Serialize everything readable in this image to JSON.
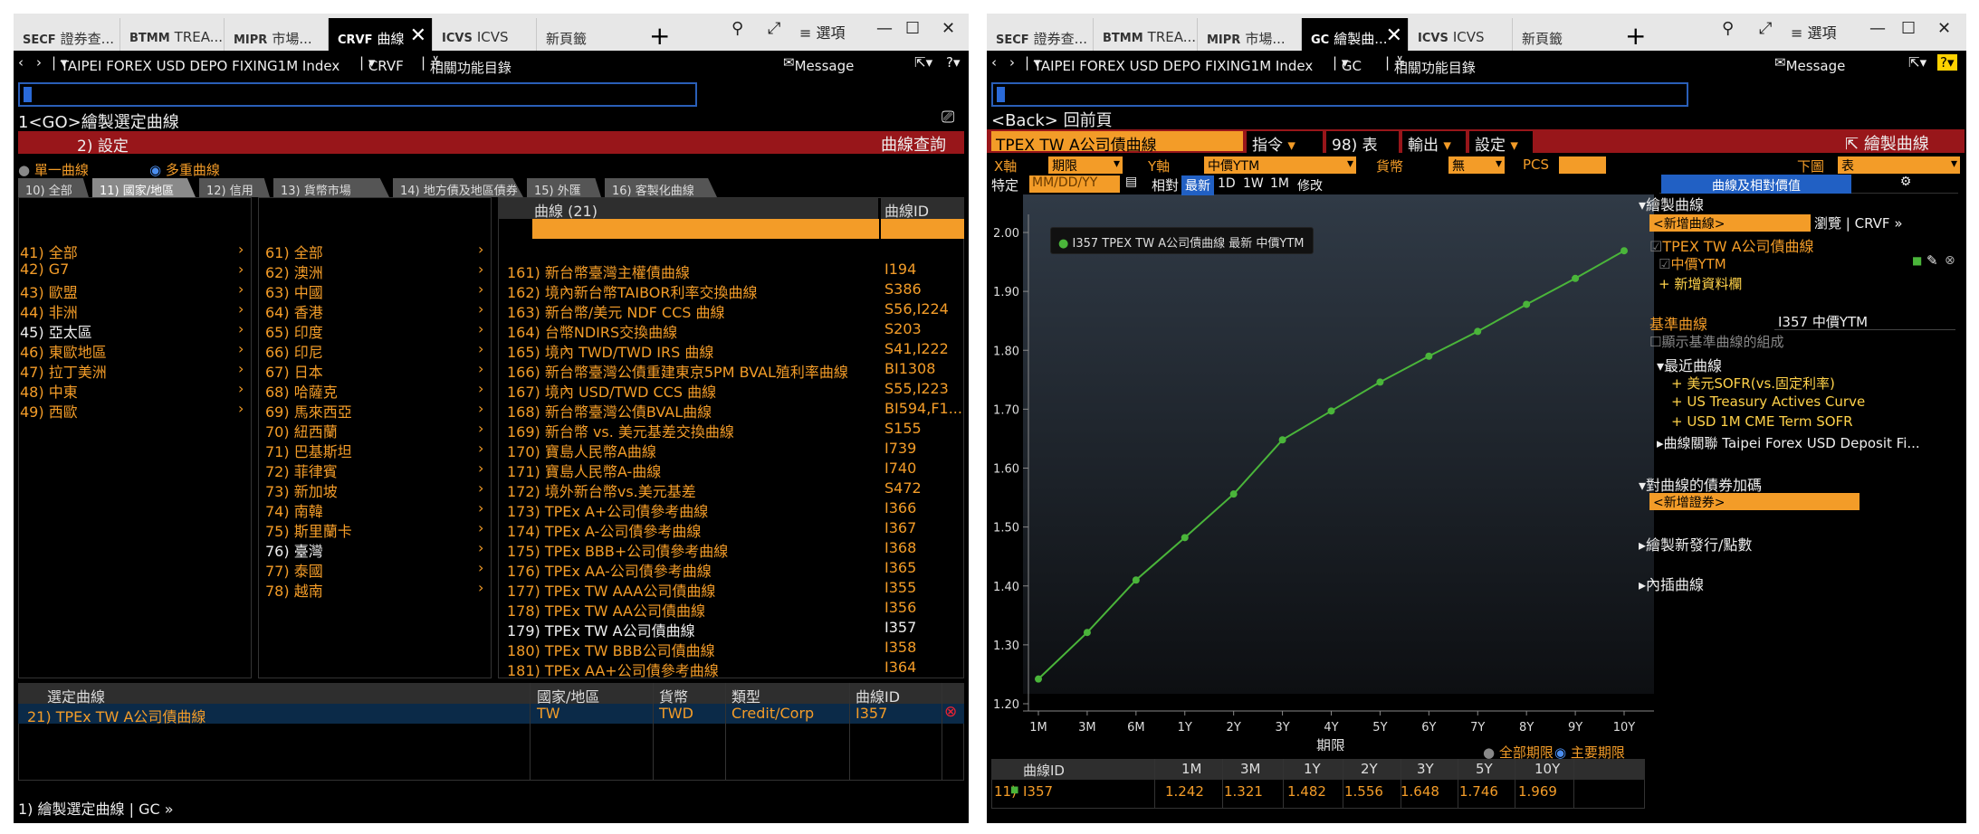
{
  "left": {
    "tabs": [
      {
        "code": "SECF",
        "label": "證券查..."
      },
      {
        "code": "BTMM",
        "label": "TREA..."
      },
      {
        "code": "MIPR",
        "label": "市場..."
      },
      {
        "code": "CRVF",
        "label": "曲線"
      },
      {
        "code": "ICVS",
        "label": "ICVS"
      },
      {
        "code": "",
        "label": "新頁籤"
      }
    ],
    "options_label": "選項",
    "nav": {
      "security": "TAIPEI FOREX USD DEPO FIXING1M Index",
      "func": "CRVF",
      "related": "相關功能目錄",
      "message": "Message"
    },
    "title": "1<GO>繪製選定曲線",
    "settings": "2) 設定",
    "curve_query": "曲線查詢",
    "mode_single": "單一曲線",
    "mode_multi": "多重曲線",
    "cat_tabs": [
      "10) 全部",
      "11) 國家/地區",
      "12) 信用",
      "13) 貨幣市場",
      "14) 地方債及地區債券",
      "15) 外匯",
      "16) 客製化曲線"
    ],
    "regions": [
      "41) 全部",
      "42) G7",
      "43) 歐盟",
      "44) 非洲",
      "45) 亞太區",
      "46) 東歐地區",
      "47) 拉丁美洲",
      "48) 中東",
      "49) 西歐"
    ],
    "countries": [
      "61) 全部",
      "62) 澳洲",
      "63) 中國",
      "64) 香港",
      "65) 印度",
      "66) 印尼",
      "67) 日本",
      "68) 哈薩克",
      "69) 馬來西亞",
      "70) 紐西蘭",
      "71) 巴基斯坦",
      "72) 菲律賓",
      "73) 新加坡",
      "74) 南韓",
      "75) 斯里蘭卡",
      "76) 臺灣",
      "77) 泰國",
      "78) 越南"
    ],
    "curves_header": "曲線 (21)",
    "curveid_header": "曲線ID",
    "curves": [
      {
        "name": "161) 新台幣臺灣主權債曲線",
        "id": "I194"
      },
      {
        "name": "162) 境內新台幣TAIBOR利率交換曲線",
        "id": "S386"
      },
      {
        "name": "163) 新台幣/美元 NDF CCS 曲線",
        "id": "S56,I224"
      },
      {
        "name": "164) 台幣NDIRS交換曲線",
        "id": "S203"
      },
      {
        "name": "165) 境內 TWD/TWD IRS 曲線",
        "id": "S41,I222"
      },
      {
        "name": "166) 新台幣臺灣公債重建東京5PM BVAL殖利率曲線",
        "id": "BI1308"
      },
      {
        "name": "167) 境內 USD/TWD CCS 曲線",
        "id": "S55,I223"
      },
      {
        "name": "168) 新台幣臺灣公債BVAL曲線",
        "id": "BI594,F1..."
      },
      {
        "name": "169) 新台幣 vs. 美元基差交換曲線",
        "id": "S155"
      },
      {
        "name": "170) 寶島人民幣A曲線",
        "id": "I739"
      },
      {
        "name": "171) 寶島人民幣A-曲線",
        "id": "I740"
      },
      {
        "name": "172) 境外新台幣vs.美元基差",
        "id": "S472"
      },
      {
        "name": "173) TPEx A+公司債參考曲線",
        "id": "I366"
      },
      {
        "name": "174) TPEx A-公司債參考曲線",
        "id": "I367"
      },
      {
        "name": "175) TPEx BBB+公司債參考曲線",
        "id": "I368"
      },
      {
        "name": "176) TPEx AA-公司債參考曲線",
        "id": "I365"
      },
      {
        "name": "177) TPEx TW AAA公司債曲線",
        "id": "I355"
      },
      {
        "name": "178) TPEx TW AA公司債曲線",
        "id": "I356"
      },
      {
        "name": "179) TPEx TW A公司債曲線",
        "id": "I357"
      },
      {
        "name": "180) TPEx TW BBB公司債曲線",
        "id": "I358"
      },
      {
        "name": "181) TPEx AA+公司債參考曲線",
        "id": "I364"
      }
    ],
    "selected_headers": [
      "選定曲線",
      "國家/地區",
      "貨幣",
      "類型",
      "曲線ID"
    ],
    "selected_row": {
      "name": "21) TPEx TW A公司債曲線",
      "country": "TW",
      "ccy": "TWD",
      "type": "Credit/Corp",
      "id": "I357"
    },
    "footer": "1) 繪製選定曲線 | GC »"
  },
  "right": {
    "tabs": [
      {
        "code": "SECF",
        "label": "證券查..."
      },
      {
        "code": "BTMM",
        "label": "TREA..."
      },
      {
        "code": "MIPR",
        "label": "市場..."
      },
      {
        "code": "GC",
        "label": "繪製曲..."
      },
      {
        "code": "ICVS",
        "label": "ICVS"
      },
      {
        "code": "",
        "label": "新頁籤"
      }
    ],
    "options_label": "選項",
    "nav": {
      "security": "TAIPEI FOREX USD DEPO FIXING1M Index",
      "func": "GC",
      "related": "相關功能目錄",
      "message": "Message"
    },
    "back": "<Back> 回前頁",
    "chart_name": "TPEX TW A公司債曲線",
    "btn_cmd": "指令",
    "btn_table": "98) 表",
    "btn_export": "輸出",
    "btn_settings": "設定",
    "plot_curve": "繪製曲線",
    "xaxis_label": "X軸",
    "xaxis_val": "期限",
    "yaxis_label": "Y軸",
    "yaxis_val": "中價YTM",
    "ccy_label": "貨幣",
    "ccy_val": "無",
    "pcs_label": "PCS",
    "lower_label": "下圖",
    "lower_val": "表",
    "specific_label": "特定",
    "date_placeholder": "MM/DD/YY",
    "rel_label": "相對",
    "periods": [
      "最新",
      "1D",
      "1W",
      "1M",
      "修改"
    ],
    "side_tab": "曲線及相對價值",
    "legend": "I357 TPEX TW A公司債曲線 最新 中價YTM",
    "side": {
      "plot_curve": "繪製曲線",
      "new_curve": "<新增曲線>",
      "browse": "瀏覽 | CRVF »",
      "curve_item": "TPEX TW A公司債曲線",
      "sub_item": "中價YTM",
      "add_data": "+ 新增資料欄",
      "benchmark_label": "基準曲線",
      "benchmark_val": "I357 中價YTM",
      "show_components": "顯示基準曲線的組成",
      "recent": "最近曲線",
      "recent_items": [
        "+ 美元SOFR(vs.固定利率)",
        "+ US Treasury Actives Curve",
        "+ USD 1M CME Term SOFR"
      ],
      "related_curves": "曲線關聯 Taipei Forex USD Deposit Fi...",
      "bond_spread": "對曲線的債券加碼",
      "new_bond": "<新增證券>",
      "new_issue": "繪製新發行/點數",
      "interp": "內插曲線"
    },
    "tenor_all": "全部期限",
    "tenor_main": "主要期限",
    "table_headers": [
      "曲線ID",
      "1M",
      "3M",
      "1Y",
      "2Y",
      "3Y",
      "5Y",
      "10Y"
    ],
    "table_row": {
      "idx": "11)",
      "id": "I357",
      "values": [
        "1.242",
        "1.321",
        "1.482",
        "1.556",
        "1.648",
        "1.746",
        "1.969"
      ]
    }
  },
  "chart_data": {
    "type": "line",
    "x": [
      "1M",
      "3M",
      "6M",
      "1Y",
      "2Y",
      "3Y",
      "4Y",
      "5Y",
      "6Y",
      "7Y",
      "8Y",
      "9Y",
      "10Y"
    ],
    "y": [
      1.242,
      1.321,
      1.41,
      1.482,
      1.556,
      1.648,
      1.697,
      1.746,
      1.79,
      1.832,
      1.878,
      1.922,
      1.969
    ],
    "yticks": [
      "2.00",
      "1.90",
      "1.80",
      "1.70",
      "1.60",
      "1.50",
      "1.40",
      "1.30",
      "1.20"
    ],
    "ylim": [
      1.2,
      2.0
    ],
    "xlabel": "期限",
    "line_color": "#4ab53a"
  }
}
